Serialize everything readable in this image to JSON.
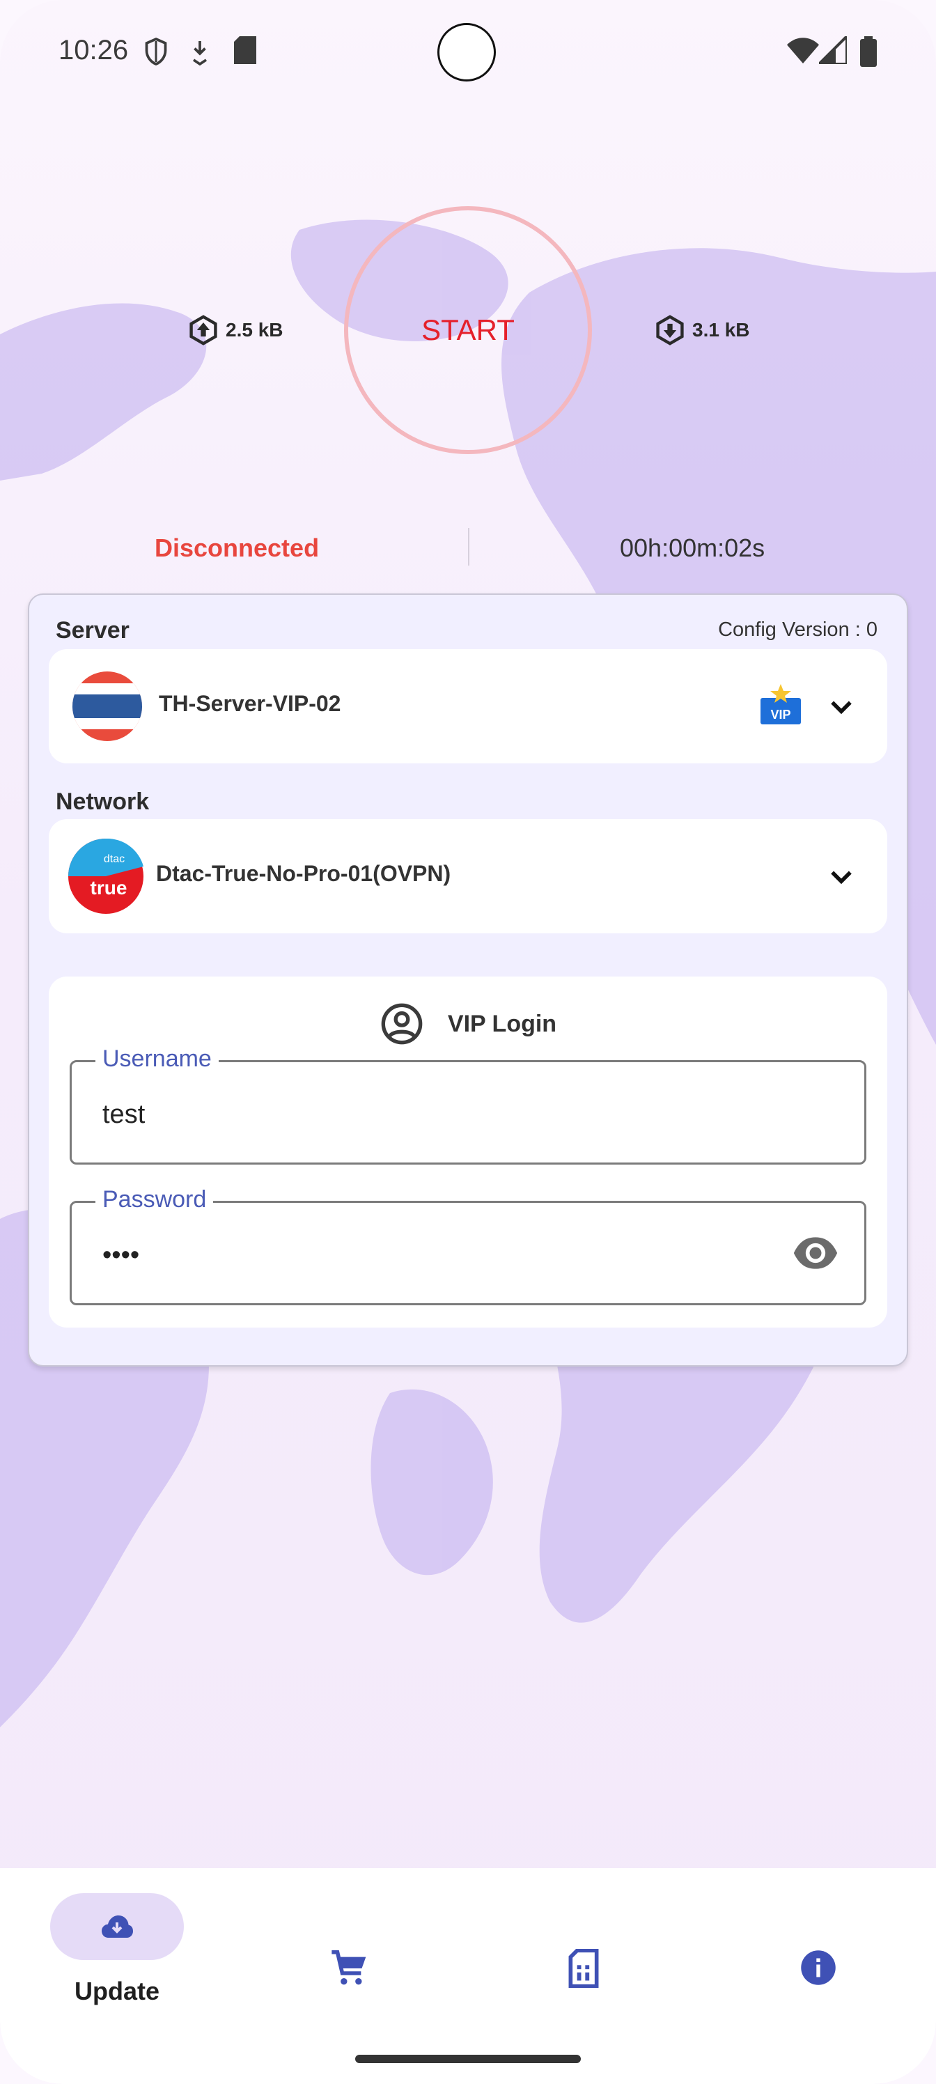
{
  "status_bar": {
    "time": "10:26"
  },
  "connection": {
    "start_label": "START",
    "upload": "2.5 kB",
    "download": "3.1 kB",
    "state": "Disconnected",
    "timer": "00h:00m:02s"
  },
  "server": {
    "section_label": "Server",
    "config_version": "Config Version : 0",
    "name": "TH-Server-VIP-02",
    "badge": "VIP"
  },
  "network": {
    "section_label": "Network",
    "name": "Dtac-True-No-Pro-01(OVPN)",
    "logo_top": "dtac",
    "logo_main": "true"
  },
  "login": {
    "title": "VIP Login",
    "username_label": "Username",
    "username_value": "test",
    "password_label": "Password",
    "password_value": "••••"
  },
  "bottom_nav": {
    "items": [
      {
        "label": "Update",
        "icon": "cloud-download-icon",
        "active": true
      },
      {
        "label": "",
        "icon": "cart-icon",
        "active": false
      },
      {
        "label": "",
        "icon": "sim-card-icon",
        "active": false
      },
      {
        "label": "",
        "icon": "info-icon",
        "active": false
      }
    ]
  },
  "colors": {
    "accent": "#3f51b5",
    "danger": "#e5202b",
    "ring": "#f4b7be",
    "card_bg": "#f1efff",
    "map": "#cdbdf2"
  }
}
